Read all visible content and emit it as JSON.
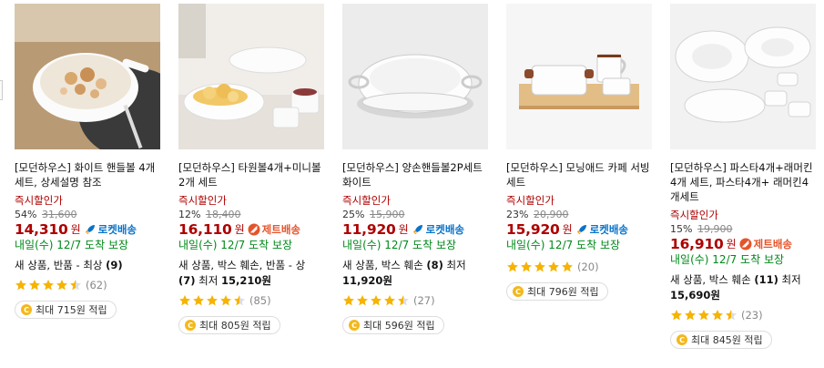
{
  "products": [
    {
      "title": "[모던하우스] 화이트 핸들볼 4개세트, 상세설명 참조",
      "instant_label": "즉시할인가",
      "discount": "54%",
      "original_price": "31,600",
      "price": "14,310",
      "won": "원",
      "badge": "로켓배송",
      "badge_type": "rocket",
      "delivery": "내일(수) 12/7 도착 보장",
      "used_prefix": "새 상품, 반품 - 최상",
      "used_count": "(9)",
      "used_suffix": "",
      "used_price": "",
      "rating": 4.5,
      "review_count": "(62)",
      "reward": "최대 715원 적립"
    },
    {
      "title": "[모던하우스] 타원볼4개+미니볼2개 세트",
      "instant_label": "즉시할인가",
      "discount": "12%",
      "original_price": "18,400",
      "price": "16,110",
      "won": "원",
      "badge": "제트배송",
      "badge_type": "jet",
      "delivery": "내일(수) 12/7 도착 보장",
      "used_prefix": "새 상품, 박스 훼손, 반품 - 상",
      "used_count": "(7)",
      "used_suffix": "최저",
      "used_price": "15,210원",
      "rating": 4.5,
      "review_count": "(85)",
      "reward": "최대 805원 적립"
    },
    {
      "title": "[모던하우스] 양손핸들볼2P세트 화이트",
      "instant_label": "즉시할인가",
      "discount": "25%",
      "original_price": "15,900",
      "price": "11,920",
      "won": "원",
      "badge": "로켓배송",
      "badge_type": "rocket",
      "delivery": "내일(수) 12/7 도착 보장",
      "used_prefix": "새 상품, 박스 훼손",
      "used_count": "(8)",
      "used_suffix": "최저",
      "used_price": "11,920원",
      "rating": 4.5,
      "review_count": "(27)",
      "reward": "최대 596원 적립"
    },
    {
      "title": "[모던하우스] 모닝애드 카페 서빙세트",
      "instant_label": "즉시할인가",
      "discount": "23%",
      "original_price": "20,900",
      "price": "15,920",
      "won": "원",
      "badge": "로켓배송",
      "badge_type": "rocket",
      "delivery": "내일(수) 12/7 도착 보장",
      "used_prefix": "",
      "used_count": "",
      "used_suffix": "",
      "used_price": "",
      "rating": 5,
      "review_count": "(20)",
      "reward": "최대 796원 적립"
    },
    {
      "title": "[모던하우스] 파스타4개+래머킨4개 세트, 파스타4개+ 래머킨4개세트",
      "instant_label": "즉시할인가",
      "discount": "15%",
      "original_price": "19,900",
      "price": "16,910",
      "won": "원",
      "badge": "제트배송",
      "badge_type": "jet",
      "delivery": "내일(수) 12/7 도착 보장",
      "used_prefix": "새 상품, 박스 훼손",
      "used_count": "(11)",
      "used_suffix": "최저",
      "used_price": "15,690원",
      "rating": 4.5,
      "review_count": "(23)",
      "reward": "최대 845원 적립"
    }
  ],
  "colors": {
    "price_red": "#ae0000",
    "rocket_blue": "#0a73c9",
    "jet_orange": "#e5542a",
    "delivery_green": "#00891a",
    "star_gold": "#f6b300"
  },
  "icons": {
    "badge_rocket": "rocket-icon",
    "badge_jet": "jet-icon",
    "reward": "coin-icon",
    "rating": "star-icon"
  }
}
